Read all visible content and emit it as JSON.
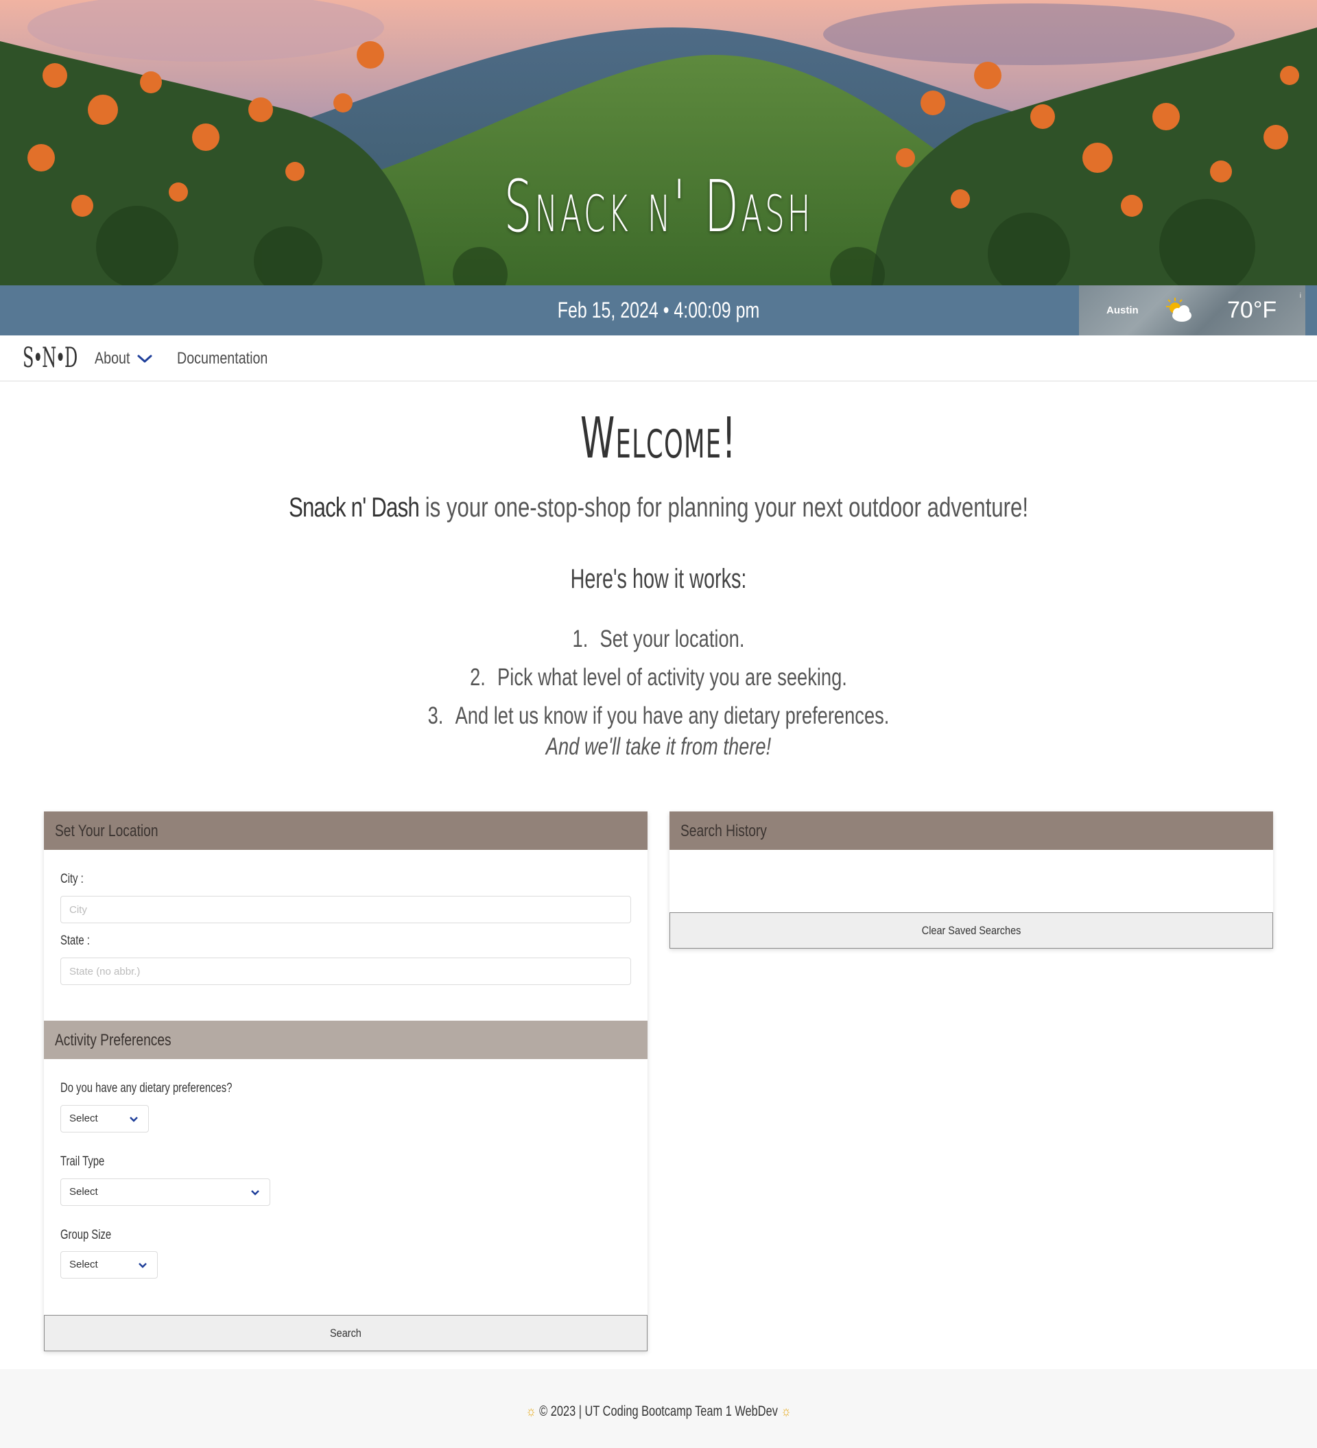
{
  "hero": {
    "title": "Snack n' Dash"
  },
  "datebar": {
    "datetime": "Feb 15, 2024 • 4:00:09 pm"
  },
  "weather": {
    "city": "Austin",
    "temperature": "70°F",
    "icon": "partly-cloudy-icon",
    "info_glyph": "i"
  },
  "nav": {
    "logo": "S•N•D",
    "about": "About",
    "documentation": "Documentation"
  },
  "welcome": {
    "title": "Welcome!",
    "intro_brand": "Snack n' Dash",
    "intro_rest": " is your one-stop-shop for planning your next outdoor adventure!",
    "how_title": "Here's how it works:",
    "steps": [
      {
        "num": "1.",
        "text": "Set your location."
      },
      {
        "num": "2.",
        "text": "Pick what level of activity you are seeking."
      },
      {
        "num": "3.",
        "text": "And let us know if you have any dietary preferences."
      }
    ],
    "tagline": "And we'll take it from there!"
  },
  "location_panel": {
    "title": "Set Your Location",
    "city_label": "City :",
    "city_placeholder": "City",
    "state_label": "State :",
    "state_placeholder": "State (no abbr.)"
  },
  "activity_panel": {
    "title": "Activity Preferences",
    "dietary_label": "Do you have any dietary preferences?",
    "dietary_value": "Select",
    "trail_label": "Trail Type",
    "trail_value": "Select",
    "group_label": "Group Size",
    "group_value": "Select",
    "search_button": "Search"
  },
  "history_panel": {
    "title": "Search History",
    "clear_button": "Clear Saved Searches"
  },
  "footer": {
    "text": "© 2023 | UT Coding Bootcamp Team 1 WebDev",
    "sun_glyph": "☼"
  },
  "colors": {
    "datebar": "#577894",
    "panel_header": "#928279",
    "panel_header_light": "#b4aaa3",
    "accent_chevron": "#1f3f9a",
    "sun": "#e6a817"
  }
}
